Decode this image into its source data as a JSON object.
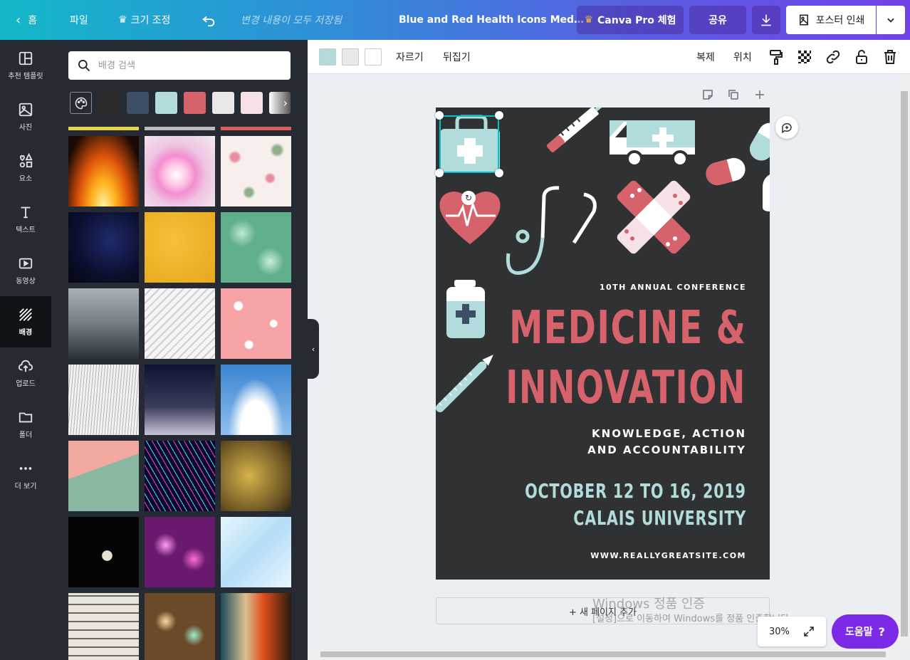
{
  "topbar": {
    "home": "홈",
    "file": "파일",
    "resize": "크기 조정",
    "saved_status": "변경 내용이 모두 저장됨",
    "doc_title": "Blue and Red Health Icons Med…",
    "pro_trial": "Canva Pro 체험",
    "share": "공유",
    "print": "포스터 인쇄"
  },
  "rail": {
    "items": [
      {
        "label": "추천 템플릿",
        "icon": "template-icon"
      },
      {
        "label": "사진",
        "icon": "photo-icon"
      },
      {
        "label": "요소",
        "icon": "shapes-icon"
      },
      {
        "label": "텍스트",
        "icon": "text-icon"
      },
      {
        "label": "동영상",
        "icon": "video-icon"
      },
      {
        "label": "배경",
        "icon": "background-icon"
      },
      {
        "label": "업로드",
        "icon": "upload-icon"
      },
      {
        "label": "폴더",
        "icon": "folder-icon"
      },
      {
        "label": "더 보기",
        "icon": "more-icon"
      }
    ],
    "active": "배경"
  },
  "panel": {
    "search_placeholder": "배경 검색",
    "swatch_colors": [
      "#2b2b2b",
      "#3d4f66",
      "#b1dcdb",
      "#d6636b",
      "#e8e8e8",
      "#f6e1e6"
    ],
    "thumbnails": [
      "fire",
      "pink-splash",
      "floral",
      "night-sky",
      "yellow-texture",
      "green-bokeh",
      "foggy-forest",
      "white-waves",
      "daisies-on-pink",
      "white-wood",
      "starry-gradient",
      "clouds",
      "court-lines",
      "lasers",
      "gold-glitter",
      "crescent-moon",
      "purple-bokeh",
      "ice",
      "birch-bark",
      "golden-bokeh",
      "abstract-paint"
    ]
  },
  "toolbar": {
    "colors": [
      "#b1dcdb",
      "#e8e8e8",
      "#ffffff"
    ],
    "crop": "자르기",
    "flip": "뒤집기",
    "duplicate": "복제",
    "position": "위치"
  },
  "poster": {
    "bg": "#303133",
    "accent_red": "#d6636b",
    "accent_teal": "#b1dcdb",
    "kicker": "10TH ANNUAL CONFERENCE",
    "title_line1": "MEDICINE &",
    "title_line2": "INNOVATION",
    "subtitle_line1": "KNOWLEDGE, ACTION",
    "subtitle_line2": "AND ACCOUNTABILITY",
    "date": "OCTOBER 12 TO 16, 2019",
    "venue": "CALAIS UNIVERSITY",
    "website": "WWW.REALLYGREATSITE.COM"
  },
  "canvas": {
    "add_page": "+ 새 페이지 추가",
    "watermark_title": "Windows 정품 인증",
    "watermark_text": "[설정]으로 이동하여 Windows를 정품 인증합니다.",
    "zoom": "30%",
    "help": "도움말"
  }
}
